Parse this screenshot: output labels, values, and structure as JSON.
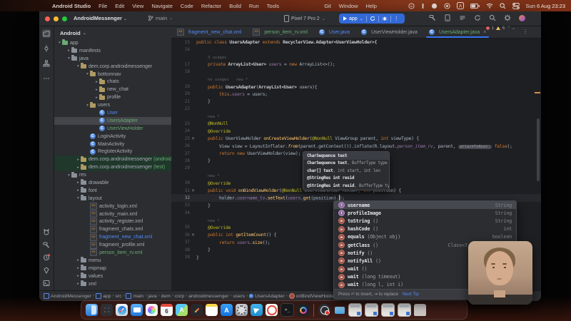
{
  "menu_bar": {
    "items": [
      "Android Studio",
      "File",
      "Edit",
      "View",
      "Navigate",
      "Code",
      "Refactor",
      "Build",
      "Run",
      "Tools",
      "Git",
      "Window",
      "Help"
    ],
    "clock": "Sun 6 Aug 23:23"
  },
  "titlebar": {
    "project": "AndroidMessenger",
    "branch": "main",
    "device": "Pixel 7 Pro 2",
    "run_config": "app"
  },
  "tabs": [
    {
      "label": "fragment_new_chat.xml",
      "icon": "xml",
      "color": "#548af7"
    },
    {
      "label": "person_item_rv.xml",
      "icon": "xml",
      "color": "#6aab73"
    },
    {
      "label": "User.java",
      "icon": "class",
      "color": "#548af7"
    },
    {
      "label": "UserViewHolder.java",
      "icon": "class",
      "color": "#9da0a8"
    },
    {
      "label": "UsersAdapter.java",
      "icon": "class",
      "color": "#6aab73",
      "active": true,
      "close": "×"
    }
  ],
  "project_tree": {
    "header": "Android",
    "items": [
      {
        "l": "app",
        "d": 1,
        "a": "v",
        "i": "app"
      },
      {
        "l": "manifests",
        "d": 2,
        "a": ">",
        "i": "folder"
      },
      {
        "l": "java",
        "d": 2,
        "a": "v",
        "i": "folder"
      },
      {
        "l": "dem.corp.androidmessenger",
        "d": 3,
        "a": "v",
        "i": "pkg"
      },
      {
        "l": "bottomnav",
        "d": 4,
        "a": "v",
        "i": "pkg"
      },
      {
        "l": "chats",
        "d": 5,
        "a": ">",
        "i": "pkg"
      },
      {
        "l": "new_chat",
        "d": 5,
        "a": ">",
        "i": "pkg"
      },
      {
        "l": "profile",
        "d": 5,
        "a": ">",
        "i": "pkg"
      },
      {
        "l": "users",
        "d": 4,
        "a": "v",
        "i": "pkg"
      },
      {
        "l": "User",
        "d": 5,
        "a": "",
        "i": "class",
        "c": "mod"
      },
      {
        "l": "UsersAdapter",
        "d": 5,
        "a": "",
        "i": "class",
        "c": "new",
        "sel": true
      },
      {
        "l": "UserViewHolder",
        "d": 5,
        "a": "",
        "i": "class",
        "c": "new"
      },
      {
        "l": "LoginActivity",
        "d": 4,
        "a": "",
        "i": "class"
      },
      {
        "l": "MainActivity",
        "d": 4,
        "a": "",
        "i": "class"
      },
      {
        "l": "RegisterActivity",
        "d": 4,
        "a": "",
        "i": "class"
      },
      {
        "l": "dem.corp.androidmessenger",
        "d": 3,
        "a": ">",
        "i": "pkg",
        "sfx": " (androidTest)",
        "bg": "green"
      },
      {
        "l": "dem.corp.androidmessenger",
        "d": 3,
        "a": ">",
        "i": "pkg",
        "sfx": " (test)",
        "bg": "green"
      },
      {
        "l": "res",
        "d": 2,
        "a": "v",
        "i": "folder"
      },
      {
        "l": "drawable",
        "d": 3,
        "a": ">",
        "i": "folder"
      },
      {
        "l": "font",
        "d": 3,
        "a": ">",
        "i": "folder"
      },
      {
        "l": "layout",
        "d": 3,
        "a": "v",
        "i": "folder"
      },
      {
        "l": "activity_login.xml",
        "d": 4,
        "a": "",
        "i": "xml"
      },
      {
        "l": "activity_main.xml",
        "d": 4,
        "a": "",
        "i": "xml"
      },
      {
        "l": "activity_register.xml",
        "d": 4,
        "a": "",
        "i": "xml"
      },
      {
        "l": "fragment_chats.xml",
        "d": 4,
        "a": "",
        "i": "xml"
      },
      {
        "l": "fragment_new_chat.xml",
        "d": 4,
        "a": "",
        "i": "xml",
        "c": "mod"
      },
      {
        "l": "fragment_profile.xml",
        "d": 4,
        "a": "",
        "i": "xml"
      },
      {
        "l": "person_item_rv.xml",
        "d": 4,
        "a": "",
        "i": "xml",
        "c": "new"
      },
      {
        "l": "menu",
        "d": 3,
        "a": ">",
        "i": "folder"
      },
      {
        "l": "mipmap",
        "d": 3,
        "a": ">",
        "i": "folder"
      },
      {
        "l": "values",
        "d": 3,
        "a": ">",
        "i": "folder"
      },
      {
        "l": "xml",
        "d": 3,
        "a": ">",
        "i": "folder"
      }
    ]
  },
  "editor": {
    "rows": [
      {
        "n": "15",
        "ind": 0,
        "seg": [
          [
            "k",
            "public class "
          ],
          [
            "w",
            "UsersAdapter "
          ],
          [
            "k",
            "extends "
          ],
          [
            "w",
            "RecyclerView.Adapter<UserViewHolder>{"
          ]
        ]
      },
      {
        "n": "16"
      },
      {
        "inlay": "3 usages",
        "ind": 1
      },
      {
        "n": "17",
        "ind": 1,
        "seg": [
          [
            "k",
            "private "
          ],
          [
            "w",
            "ArrayList<User> "
          ],
          [
            "f",
            "users"
          ],
          [
            "p",
            " = "
          ],
          [
            "k",
            "new "
          ],
          [
            "p",
            "ArrayList<>();"
          ]
        ]
      },
      {
        "n": "18"
      },
      {
        "inlay": "no usages   new *",
        "ind": 1
      },
      {
        "n": "19",
        "ind": 1,
        "seg": [
          [
            "k",
            "public "
          ],
          [
            "w",
            "UsersAdapter"
          ],
          [
            "p",
            "("
          ],
          [
            "w",
            "ArrayList<User> "
          ],
          [
            "p",
            "users){"
          ]
        ]
      },
      {
        "n": "20",
        "ind": 2,
        "seg": [
          [
            "k",
            "this"
          ],
          [
            "p",
            "."
          ],
          [
            "f",
            "users"
          ],
          [
            "p",
            " = users;"
          ]
        ]
      },
      {
        "n": "21",
        "ind": 1,
        "seg": [
          [
            "p",
            "}"
          ]
        ]
      },
      {
        "n": "22"
      },
      {
        "inlay": "new *",
        "ind": 1
      },
      {
        "n": "23",
        "ind": 1,
        "seg": [
          [
            "a",
            "@NonNull"
          ]
        ]
      },
      {
        "n": "24",
        "ind": 1,
        "seg": [
          [
            "a",
            "@Override"
          ]
        ]
      },
      {
        "n": "25",
        "ind": 1,
        "mark": true,
        "seg": [
          [
            "k",
            "public "
          ],
          [
            "p",
            "UserViewHolder "
          ],
          [
            "m",
            "onCreateViewHolder"
          ],
          [
            "p",
            "("
          ],
          [
            "a",
            "@NonNull "
          ],
          [
            "p",
            "ViewGroup parent, "
          ],
          [
            "k",
            "int "
          ],
          [
            "p",
            "viewType) {"
          ]
        ]
      },
      {
        "n": "26",
        "ind": 2,
        "seg": [
          [
            "p",
            "View view = LayoutInflater."
          ],
          [
            "im",
            "from"
          ],
          [
            "p",
            "(parent.getContext()).inflate(R.layout."
          ],
          [
            "if",
            "person_item_rv"
          ],
          [
            "p",
            ", parent, "
          ],
          [
            "pill",
            "attachToRoot:"
          ],
          [
            "k",
            " false"
          ],
          [
            "p",
            ");"
          ]
        ]
      },
      {
        "n": "27",
        "ind": 2,
        "seg": [
          [
            "k",
            "return new "
          ],
          [
            "p",
            "UserViewHolder(view);"
          ]
        ]
      },
      {
        "n": "28",
        "ind": 1,
        "seg": [
          [
            "p",
            "}"
          ]
        ]
      },
      {
        "n": "29"
      },
      {
        "inlay": "new *",
        "ind": 1
      },
      {
        "n": "30",
        "ind": 1,
        "seg": [
          [
            "a",
            "@Override"
          ]
        ]
      },
      {
        "n": "31",
        "ind": 1,
        "mark": true,
        "seg": [
          [
            "k",
            "public void "
          ],
          [
            "m",
            "onBindViewHolder"
          ],
          [
            "p",
            "("
          ],
          [
            "a",
            "@NonNull "
          ],
          [
            "p",
            "UserViewHolder holder, "
          ],
          [
            "k",
            "int "
          ],
          [
            "p",
            "position) {"
          ]
        ]
      },
      {
        "n": "32",
        "ind": 2,
        "cur": true,
        "seg": [
          [
            "p",
            "holder."
          ],
          [
            "f",
            "username_tv"
          ],
          [
            "p",
            "."
          ],
          [
            "m",
            "setText"
          ],
          [
            "p",
            "("
          ],
          [
            "f",
            "users"
          ],
          [
            "p",
            "."
          ],
          [
            "m",
            "get"
          ],
          [
            "p",
            "(position)."
          ],
          [
            "caret",
            ""
          ],
          [
            "p",
            ");"
          ]
        ]
      },
      {
        "n": "33",
        "ind": 1,
        "seg": [
          [
            "p",
            "}"
          ]
        ]
      },
      {
        "n": "34"
      },
      {
        "inlay": "new *",
        "ind": 1
      },
      {
        "n": "35",
        "ind": 1,
        "seg": [
          [
            "a",
            "@Override"
          ]
        ]
      },
      {
        "n": "36",
        "ind": 1,
        "mark": true,
        "seg": [
          [
            "k",
            "public int "
          ],
          [
            "m",
            "getItemCount"
          ],
          [
            "p",
            "() {"
          ]
        ]
      },
      {
        "n": "37",
        "ind": 2,
        "seg": [
          [
            "k",
            "return "
          ],
          [
            "f",
            "users"
          ],
          [
            "p",
            "."
          ],
          [
            "m",
            "size"
          ],
          [
            "p",
            "();"
          ]
        ]
      },
      {
        "n": "38",
        "ind": 1,
        "seg": [
          [
            "p",
            "}"
          ]
        ]
      },
      {
        "n": "39",
        "ind": 0,
        "seg": [
          [
            "p",
            "}"
          ]
        ]
      }
    ]
  },
  "inspection_widget": {
    "errors": "1",
    "warnings": "6"
  },
  "param_popup": {
    "rows": [
      {
        "b": "CharSequence text",
        "r": "",
        "hl": true
      },
      {
        "b": "CharSequence text",
        "r": ", BufferType type"
      },
      {
        "b": "char[] text",
        "r": ", int start, int len"
      },
      {
        "b": "@StringRes int resid",
        "r": ""
      },
      {
        "b": "@StringRes int resid",
        "r": ", BufferType type"
      }
    ]
  },
  "completion": {
    "items": [
      {
        "icon": "f",
        "label": "username",
        "params": "",
        "type": "String",
        "sel": true
      },
      {
        "icon": "f",
        "label": "profileImage",
        "params": "",
        "type": "String"
      },
      {
        "icon": "m",
        "label": "toString",
        "params": "()",
        "type": "String"
      },
      {
        "icon": "m",
        "label": "hashCode",
        "params": "()",
        "type": "int"
      },
      {
        "icon": "m",
        "label": "equals",
        "params": "(Object obj)",
        "type": "boolean"
      },
      {
        "icon": "m",
        "label": "getClass",
        "params": "()",
        "type": "Class<? extends Object>"
      },
      {
        "icon": "m",
        "label": "notify",
        "params": "()",
        "type": ""
      },
      {
        "icon": "m",
        "label": "notifyAll",
        "params": "()",
        "type": ""
      },
      {
        "icon": "m",
        "label": "wait",
        "params": "()",
        "type": ""
      },
      {
        "icon": "m",
        "label": "wait",
        "params": "(long timeout)",
        "type": ""
      },
      {
        "icon": "m",
        "label": "wait",
        "params": "(long l, int i)",
        "type": ""
      }
    ],
    "footer": "Press ⏎ to insert, ⇥ to replace",
    "next_tip": "Next Tip"
  },
  "breadcrumbs": [
    {
      "label": "AndroidMessenger",
      "icon": "module"
    },
    {
      "label": "app",
      "icon": "module"
    },
    {
      "label": "src"
    },
    {
      "label": "main",
      "icon": "module"
    },
    {
      "label": "java"
    },
    {
      "label": "dem"
    },
    {
      "label": "corp"
    },
    {
      "label": "androidmessenger"
    },
    {
      "label": "users"
    },
    {
      "label": "UsersAdapter",
      "icon": "class"
    },
    {
      "label": "onBindViewHolder",
      "icon": "method"
    }
  ],
  "left_stripe": {
    "top": [
      "project",
      "commit",
      "structure",
      "more"
    ],
    "bottom": [
      "logcat",
      "build",
      "recent",
      "app-quality-insights",
      "terminal",
      "version-control"
    ]
  },
  "right_stripe": [
    "notifications",
    "gradle",
    "device-manager",
    "running-devices"
  ],
  "dock": {
    "calendar_day": "6",
    "maps_letter": "A",
    "appstore_letter": "A",
    "terminal_glyph": ">_",
    "items": [
      "finder",
      "launchpad",
      "safari",
      "mail",
      "photos",
      "calendar",
      "maps",
      "freeform",
      "notes",
      "appstore",
      "settings",
      "telegram",
      "music",
      "terminal",
      "android-studio",
      "separator",
      "obs",
      "downloads-folder",
      "window",
      "window",
      "window",
      "window",
      "trash"
    ],
    "running": [
      "finder",
      "safari",
      "mail",
      "photos",
      "freeform",
      "settings",
      "telegram",
      "music",
      "terminal",
      "android-studio",
      "obs"
    ]
  },
  "colors": {
    "accent_blue": "#3574f0",
    "vcs_modified": "#548af7",
    "vcs_new": "#6aab73",
    "error_red": "#db5c5c",
    "warning_yellow": "#f2c55c"
  }
}
